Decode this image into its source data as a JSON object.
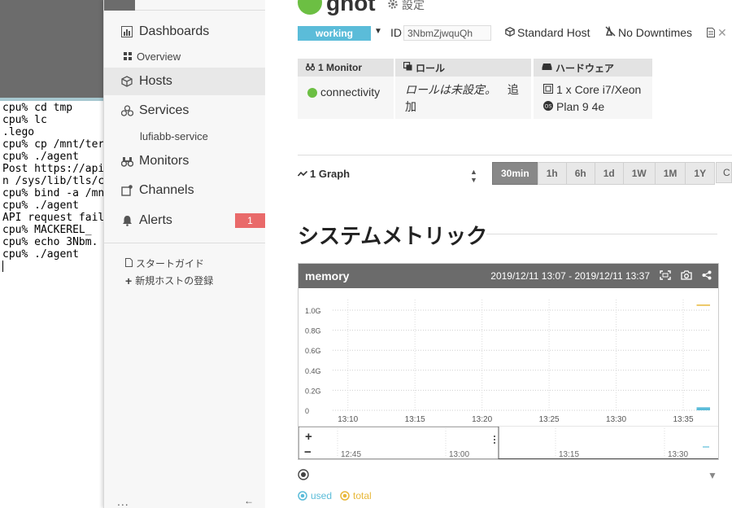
{
  "terminal": {
    "lines": [
      "cpu% cd tmp",
      "cpu% lc",
      ".lego",
      "cpu% cp /mnt/ter",
      "cpu% ./agent",
      "Post https://api.m",
      "n /sys/lib/tls/ca.p",
      "cpu% bind -a /mn",
      "cpu% ./agent",
      "API request failed",
      "cpu% MACKEREL_",
      "cpu% echo 3Nbm.",
      "cpu% ./agent"
    ]
  },
  "sidebar": {
    "items": [
      {
        "label": "Dashboards",
        "icon": "chart-icon"
      },
      {
        "label": "Hosts",
        "icon": "cube-icon"
      },
      {
        "label": "Services",
        "icon": "services-icon"
      },
      {
        "label": "Monitors",
        "icon": "binoculars-icon"
      },
      {
        "label": "Channels",
        "icon": "channel-icon"
      },
      {
        "label": "Alerts",
        "icon": "bell-icon"
      }
    ],
    "sub": {
      "overview": "Overview",
      "service": "lufiabb-service"
    },
    "alerts_badge": "1",
    "links": {
      "start_guide": "スタートガイド",
      "register_host": "新規ホストの登録"
    },
    "footer_dots": "...",
    "footer_arrow": "←"
  },
  "host": {
    "name": "gnot",
    "settings_label": "設定",
    "status": "working",
    "id_label": "ID",
    "id": "3NbmZjwquQh",
    "host_type": "Standard Host",
    "downtimes": "No Downtimes",
    "status_color": "#6cbf43"
  },
  "info": {
    "monitor": {
      "header": "1 Monitor",
      "value": "connectivity"
    },
    "role": {
      "header": "ロール",
      "text": "ロールは未設定。",
      "add": "追加"
    },
    "hardware": {
      "header": "ハードウェア",
      "cpu": "1 x Core i7/Xeon",
      "os": "Plan 9 4e"
    }
  },
  "graph_controls": {
    "count_label": "1 Graph",
    "ranges": [
      "30min",
      "1h",
      "6h",
      "1d",
      "1W",
      "1M",
      "1Y"
    ],
    "active_range": "30min",
    "refresh": "C"
  },
  "section_title": "システムメトリック",
  "memory_graph": {
    "title": "memory",
    "range": "2019/12/11 13:07 - 2019/12/11 13:37",
    "zoom_in": "+",
    "zoom_out": "−",
    "zoom_ticks": [
      "12:45",
      "13:00",
      "13:15",
      "13:30"
    ]
  },
  "legend": {
    "used": "used",
    "total": "total"
  },
  "chart_data": {
    "type": "line",
    "title": "memory",
    "xlabel": "",
    "ylabel": "",
    "x_ticks": [
      "13:10",
      "13:15",
      "13:20",
      "13:25",
      "13:30",
      "13:35"
    ],
    "y_ticks": [
      "0",
      "0.2G",
      "0.4G",
      "0.6G",
      "0.8G",
      "1.0G"
    ],
    "ylim": [
      0,
      1.0
    ],
    "grid": true,
    "series": [
      {
        "name": "used",
        "color": "#5bbcd9",
        "x": [
          "13:36",
          "13:37"
        ],
        "values": [
          0.03,
          0.03
        ]
      },
      {
        "name": "total",
        "color": "#e8b83a",
        "x": [
          "13:36",
          "13:37"
        ],
        "values": [
          1.05,
          1.05
        ]
      }
    ]
  }
}
